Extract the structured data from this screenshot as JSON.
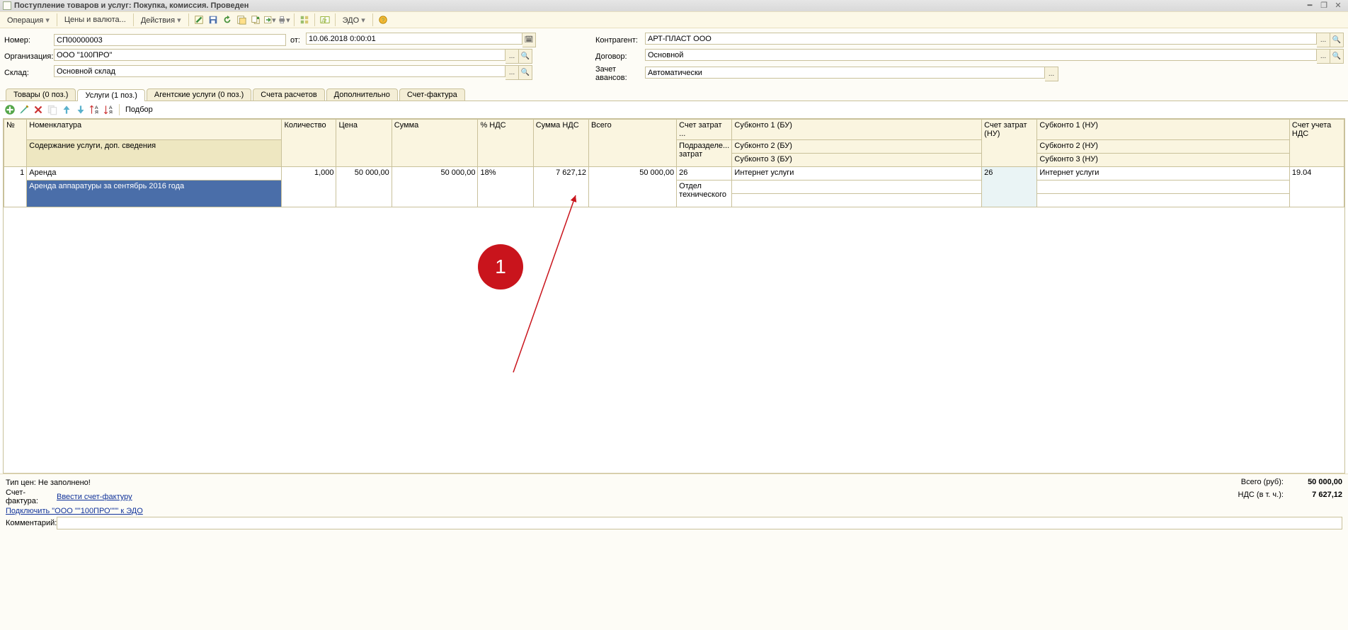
{
  "window": {
    "title": "Поступление товаров и услуг: Покупка, комиссия. Проведен"
  },
  "toolbar": {
    "operation": "Операция",
    "prices": "Цены и валюта...",
    "actions": "Действия",
    "edo": "ЭДО"
  },
  "header": {
    "number_label": "Номер:",
    "number_value": "СП00000003",
    "from_label": "от:",
    "date_value": "10.06.2018 0:00:01",
    "org_label": "Организация:",
    "org_value": "ООО \"100ПРО\"",
    "sklad_label": "Склад:",
    "sklad_value": "Основной склад",
    "kontragent_label": "Контрагент:",
    "kontragent_value": "АРТ-ПЛАСТ ООО",
    "dogovor_label": "Договор:",
    "dogovor_value": "Основной",
    "zachet_label": "Зачет авансов:",
    "zachet_value": "Автоматически"
  },
  "tabs": {
    "t1": "Товары (0 поз.)",
    "t2": "Услуги (1 поз.)",
    "t3": "Агентские услуги (0 поз.)",
    "t4": "Счета расчетов",
    "t5": "Дополнительно",
    "t6": "Счет-фактура"
  },
  "podbor": "Подбор",
  "table": {
    "headers": {
      "n": "№",
      "nom": "Номенклатура",
      "nom_sub": "Содержание услуги, доп. сведения",
      "kol": "Количество",
      "price": "Цена",
      "sum": "Сумма",
      "pnds": "% НДС",
      "sumnds": "Сумма НДС",
      "vsego": "Всего",
      "schzat": "Счет затрат ...",
      "schzat_sub": "Подразделе... затрат",
      "sub1": "Субконто 1 (БУ)",
      "sub2": "Субконто 2 (БУ)",
      "sub3": "Субконто 3 (БУ)",
      "schnu": "Счет затрат (НУ)",
      "subnu1": "Субконто 1 (НУ)",
      "subnu2": "Субконто 2 (НУ)",
      "subnu3": "Субконто 3 (НУ)",
      "ndsacc": "Счет учета НДС"
    },
    "row": {
      "n": "1",
      "nom": "Аренда",
      "nom_sub": "Аренда аппаратуры за сентябрь 2016 года",
      "kol": "1,000",
      "price": "50 000,00",
      "sum": "50 000,00",
      "pnds": "18%",
      "sumnds": "7 627,12",
      "vsego": "50 000,00",
      "schzat": "26",
      "schzat_sub": "Отдел технического",
      "sub1": "Интернет услуги",
      "schnu": "26",
      "subnu1": "Интернет услуги",
      "ndsacc": "19.04"
    }
  },
  "annotation": {
    "num": "1"
  },
  "footer": {
    "pricetype": "Тип цен: Не заполнено!",
    "sf_label": "Счет-фактура:",
    "sf_link": "Ввести счет-фактуру",
    "edo_link": "Подключить \"ООО \"\"100ПРО\"\"\" к ЭДО",
    "comment_label": "Комментарий:",
    "total_label": "Всего (руб):",
    "total_value": "50 000,00",
    "nds_label": "НДС (в т. ч.):",
    "nds_value": "7 627,12"
  }
}
